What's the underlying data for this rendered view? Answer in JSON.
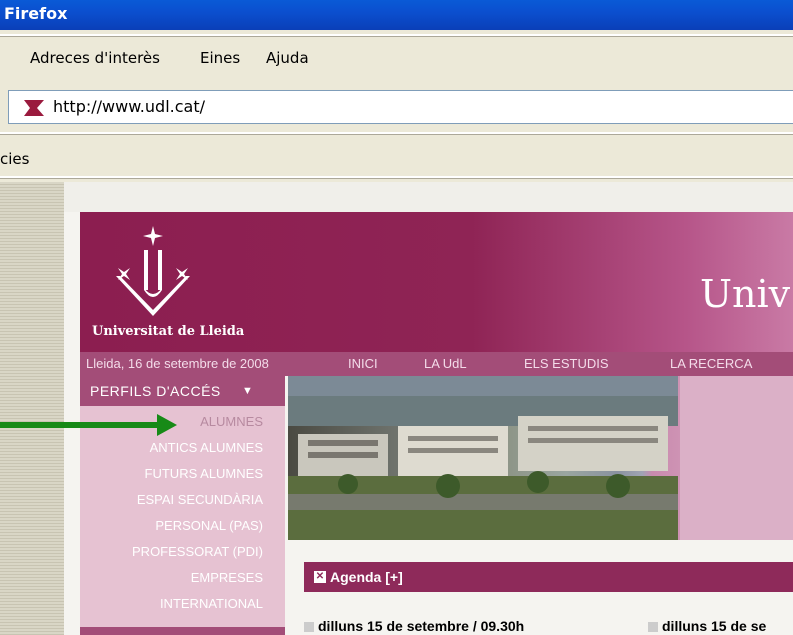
{
  "window": {
    "title": "Firefox"
  },
  "menu": {
    "items": [
      "Adreces d'interès",
      "Eines",
      "Ajuda"
    ]
  },
  "address": {
    "url": "http://www.udl.cat/"
  },
  "bookmarks": {
    "label": "cies"
  },
  "site": {
    "logo_text": "Universitat de Lleida",
    "big_title": "Univ",
    "date": "Lleida, 16 de setembre de 2008",
    "nav": [
      "INICI",
      "LA UdL",
      "ELS ESTUDIS",
      "LA RECERCA"
    ],
    "sidebar": {
      "title": "PERFILS D'ACCÉS",
      "arrow": "▼",
      "items": [
        "ALUMNES",
        "ANTICS ALUMNES",
        "FUTURS ALUMNES",
        "ESPAI SECUNDÀRIA",
        "PERSONAL (PAS)",
        "PROFESSORAT (PDI)",
        "EMPRESES",
        "INTERNATIONAL"
      ]
    },
    "agenda": {
      "title": "Agenda [+]",
      "entries": [
        "dilluns 15 de setembre / 09.30h",
        "dilluns 15 de se"
      ]
    }
  },
  "colors": {
    "brand": "#8c1e50",
    "nav": "#a34d78",
    "sidebar": "#e6c2d2",
    "annotation_arrow": "#178a17"
  }
}
